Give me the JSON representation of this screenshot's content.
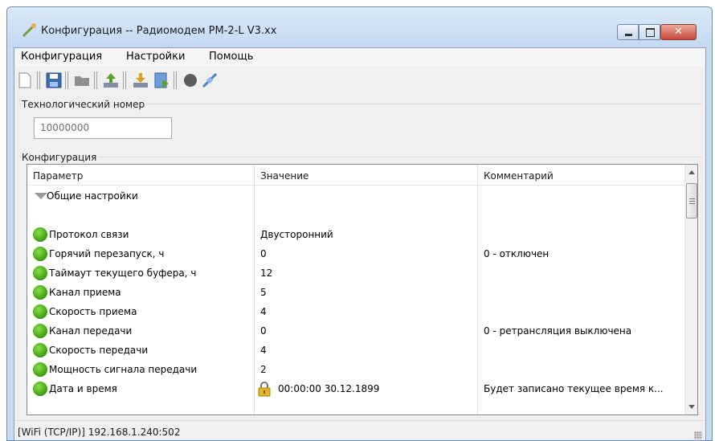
{
  "window": {
    "title": "Конфигурация -- Радиомодем РМ-2-L V3.xx",
    "close_glyph": "✕"
  },
  "menu": [
    "Конфигурация",
    "Настройки",
    "Помощь"
  ],
  "toolbar": {
    "icons": [
      "new-file-icon",
      "save-icon",
      "folder-icon",
      "upload-icon",
      "download-icon",
      "export-icon",
      "record-icon",
      "connect-icon"
    ]
  },
  "tech_number": {
    "label": "Технологический номер",
    "value": "10000000"
  },
  "config": {
    "label": "Конфигурация",
    "columns": [
      "Параметр",
      "Значение",
      "Комментарий"
    ],
    "group_title": "Общие настройки",
    "rows": [
      {
        "param": "Протокол связи",
        "value": "Двусторонний",
        "comment": ""
      },
      {
        "param": "Горячий перезапуск, ч",
        "value": "0",
        "comment": "0 - отключен"
      },
      {
        "param": "Таймаут текущего буфера, ч",
        "value": "12",
        "comment": ""
      },
      {
        "param": "Канал приема",
        "value": "5",
        "comment": ""
      },
      {
        "param": "Скорость приема",
        "value": "4",
        "comment": ""
      },
      {
        "param": "Канал передачи",
        "value": "0",
        "comment": "0 - ретрансляция выключена"
      },
      {
        "param": "Скорость передачи",
        "value": "4",
        "comment": ""
      },
      {
        "param": "Мощность сигнала передачи",
        "value": "2",
        "comment": ""
      },
      {
        "param": "Дата и время",
        "value": "00:00:00 30.12.1899",
        "comment": "Будет записано текущее время к..."
      }
    ]
  },
  "status": {
    "text": "[WiFi (TCP/IP)] 192.168.1.240:502"
  },
  "colors": {
    "status_ok": "#3d9a0f",
    "title_bar": "#c4d9f1"
  }
}
